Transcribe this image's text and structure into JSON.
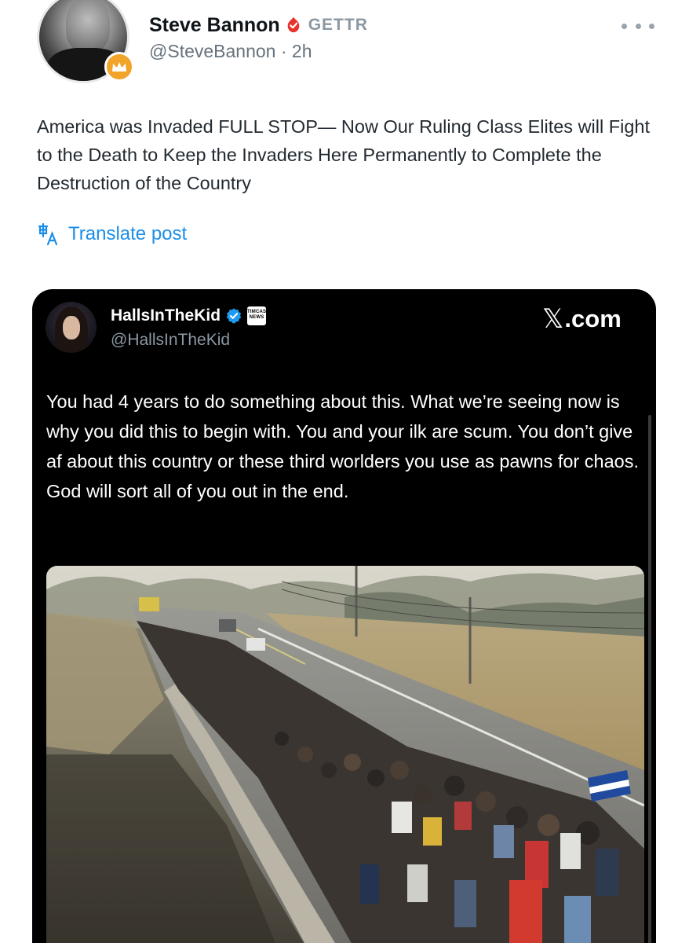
{
  "post": {
    "author_name": "Steve Bannon",
    "platform_label": "GETTR",
    "handle_line": "@SteveBannon · 2h",
    "text": "America was Invaded FULL STOP— Now Our Ruling Class Elites will Fight to the Death to Keep the Invaders Here Permanently to Complete the Destruction of the Country",
    "translate_label": "Translate post",
    "icons": [
      "crown-icon",
      "gettr-flame-icon",
      "more-icon",
      "translate-icon"
    ],
    "accent_color": "#1d8ee8"
  },
  "quoted_card": {
    "author_name": "HallsInTheKid",
    "handle": "@HallsInTheKid",
    "affiliation_badge": "TIMCAST NEWS",
    "source_x": "𝕏",
    "source_label": ".com",
    "text": "You had 4 years to do something about this. What we’re seeing now is why you did this to begin with. You and your ilk are scum. You don’t give af about this country or these third worlders you use as pawns for chaos. God will sort all of you out in the end.",
    "icons": [
      "verified-icon",
      "x-logo-icon"
    ],
    "background_color": "#000000"
  }
}
